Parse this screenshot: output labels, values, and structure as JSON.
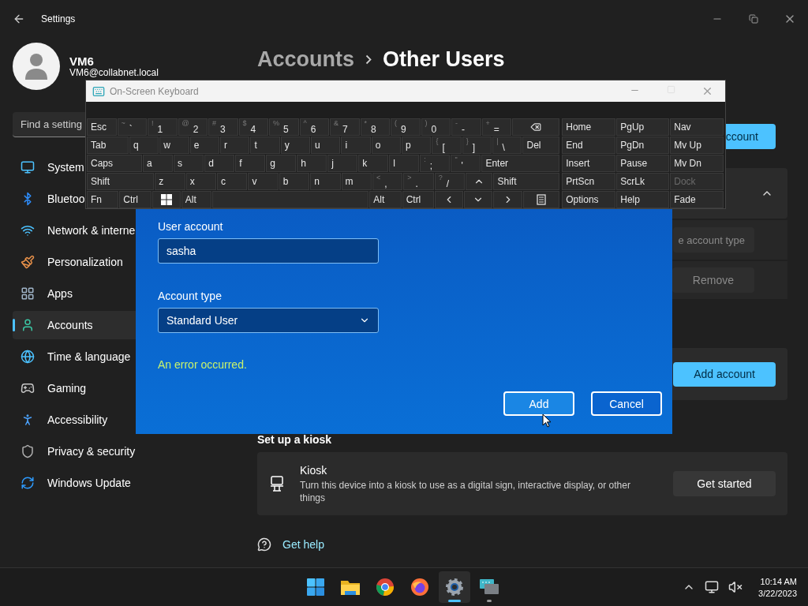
{
  "settings": {
    "title": "Settings",
    "user": {
      "name": "VM6",
      "email": "VM6@collabnet.local"
    },
    "search": {
      "placeholder": "Find a setting"
    },
    "nav": [
      {
        "label": "System",
        "kind": "system",
        "selected": false
      },
      {
        "label": "Bluetoo",
        "kind": "bluetooth",
        "selected": false
      },
      {
        "label": "Network & interne",
        "kind": "network",
        "selected": false
      },
      {
        "label": "Personalization",
        "kind": "personalization",
        "selected": false
      },
      {
        "label": "Apps",
        "kind": "apps",
        "selected": false
      },
      {
        "label": "Accounts",
        "kind": "accounts",
        "selected": true
      },
      {
        "label": "Time & language",
        "kind": "time",
        "selected": false
      },
      {
        "label": "Gaming",
        "kind": "gaming",
        "selected": false
      },
      {
        "label": "Accessibility",
        "kind": "accessibility",
        "selected": false
      },
      {
        "label": "Privacy & security",
        "kind": "privacy",
        "selected": false
      },
      {
        "label": "Windows Update",
        "kind": "update",
        "selected": false
      }
    ],
    "breadcrumb": {
      "parent": "Accounts",
      "current": "Other Users"
    },
    "other_users": {
      "button": "ccount",
      "account": {
        "expanded": true
      },
      "options": [
        {
          "label": "e account type",
          "disabled": true
        },
        {
          "label": "Remove",
          "disabled": true
        }
      ]
    },
    "work_account": {
      "button": "Add account"
    },
    "kiosk": {
      "heading": "Set up a kiosk",
      "title": "Kiosk",
      "description": "Turn this device into a kiosk to use as a digital sign, interactive display, or other things",
      "button": "Get started"
    },
    "help": {
      "label": "Get help"
    }
  },
  "keyboard": {
    "title": "On-Screen Keyboard",
    "rows": [
      [
        {
          "kind": "text",
          "label": "Esc"
        },
        {
          "kind": "char",
          "shift": "~",
          "label": "`"
        },
        {
          "kind": "char",
          "shift": "!",
          "label": "1"
        },
        {
          "kind": "char",
          "shift": "@",
          "label": "2"
        },
        {
          "kind": "char",
          "shift": "#",
          "label": "3"
        },
        {
          "kind": "char",
          "shift": "$",
          "label": "4"
        },
        {
          "kind": "char",
          "shift": "%",
          "label": "5"
        },
        {
          "kind": "char",
          "shift": "^",
          "label": "6"
        },
        {
          "kind": "char",
          "shift": "&",
          "label": "7"
        },
        {
          "kind": "char",
          "shift": "*",
          "label": "8"
        },
        {
          "kind": "char",
          "shift": "(",
          "label": "9"
        },
        {
          "kind": "char",
          "shift": ")",
          "label": "0"
        },
        {
          "kind": "char",
          "shift": "-",
          "label": "-"
        },
        {
          "kind": "char",
          "shift": "+",
          "label": "="
        },
        {
          "kind": "backspace"
        }
      ],
      [
        {
          "kind": "text",
          "label": "Tab"
        },
        {
          "kind": "text",
          "label": "q"
        },
        {
          "kind": "text",
          "label": "w"
        },
        {
          "kind": "text",
          "label": "e"
        },
        {
          "kind": "text",
          "label": "r"
        },
        {
          "kind": "text",
          "label": "t"
        },
        {
          "kind": "text",
          "label": "y"
        },
        {
          "kind": "text",
          "label": "u"
        },
        {
          "kind": "text",
          "label": "i"
        },
        {
          "kind": "text",
          "label": "o"
        },
        {
          "kind": "text",
          "label": "p"
        },
        {
          "kind": "char",
          "shift": "{",
          "label": "["
        },
        {
          "kind": "char",
          "shift": "}",
          "label": "]"
        },
        {
          "kind": "char",
          "shift": "|",
          "label": "\\"
        },
        {
          "kind": "text",
          "label": "Del"
        }
      ],
      [
        {
          "kind": "text",
          "label": "Caps"
        },
        {
          "kind": "text",
          "label": "a"
        },
        {
          "kind": "text",
          "label": "s"
        },
        {
          "kind": "text",
          "label": "d"
        },
        {
          "kind": "text",
          "label": "f"
        },
        {
          "kind": "text",
          "label": "g"
        },
        {
          "kind": "text",
          "label": "h"
        },
        {
          "kind": "text",
          "label": "j"
        },
        {
          "kind": "text",
          "label": "k"
        },
        {
          "kind": "text",
          "label": "l"
        },
        {
          "kind": "char",
          "shift": ":",
          "label": ";"
        },
        {
          "kind": "char",
          "shift": "\"",
          "label": "'"
        },
        {
          "kind": "text",
          "label": "Enter"
        }
      ],
      [
        {
          "kind": "text",
          "label": "Shift"
        },
        {
          "kind": "text",
          "label": "z"
        },
        {
          "kind": "text",
          "label": "x"
        },
        {
          "kind": "text",
          "label": "c"
        },
        {
          "kind": "text",
          "label": "v"
        },
        {
          "kind": "text",
          "label": "b"
        },
        {
          "kind": "text",
          "label": "n"
        },
        {
          "kind": "text",
          "label": "m"
        },
        {
          "kind": "char",
          "shift": "<",
          "label": ","
        },
        {
          "kind": "char",
          "shift": ">",
          "label": "."
        },
        {
          "kind": "char",
          "shift": "?",
          "label": "/"
        },
        {
          "kind": "up"
        },
        {
          "kind": "text",
          "label": "Shift"
        }
      ],
      [
        {
          "kind": "text",
          "label": "Fn"
        },
        {
          "kind": "text",
          "label": "Ctrl"
        },
        {
          "kind": "win"
        },
        {
          "kind": "text",
          "label": "Alt"
        },
        {
          "kind": "space"
        },
        {
          "kind": "text",
          "label": "Alt"
        },
        {
          "kind": "text",
          "label": "Ctrl"
        },
        {
          "kind": "left"
        },
        {
          "kind": "down"
        },
        {
          "kind": "right"
        },
        {
          "kind": "menu"
        }
      ]
    ],
    "nav_rows": [
      [
        {
          "label": "Home",
          "disabled": false
        },
        {
          "label": "PgUp",
          "disabled": false
        },
        {
          "label": "Nav",
          "disabled": false
        }
      ],
      [
        {
          "label": "End",
          "disabled": false
        },
        {
          "label": "PgDn",
          "disabled": false
        },
        {
          "label": "Mv Up",
          "disabled": false
        }
      ],
      [
        {
          "label": "Insert",
          "disabled": false
        },
        {
          "label": "Pause",
          "disabled": false
        },
        {
          "label": "Mv Dn",
          "disabled": false
        }
      ],
      [
        {
          "label": "PrtScn",
          "disabled": false
        },
        {
          "label": "ScrLk",
          "disabled": false
        },
        {
          "label": "Dock",
          "disabled": true
        }
      ],
      [
        {
          "label": "Options",
          "disabled": false
        },
        {
          "label": "Help",
          "disabled": false
        },
        {
          "label": "Fade",
          "disabled": false
        }
      ]
    ]
  },
  "dialog": {
    "fields": [
      {
        "kind": "text",
        "label": "User account",
        "value": "sasha"
      },
      {
        "kind": "select",
        "label": "Account type",
        "value": "Standard User"
      }
    ],
    "error": "An error occurred.",
    "buttons": [
      {
        "label": "Add",
        "primary": true
      },
      {
        "label": "Cancel",
        "primary": false
      }
    ]
  },
  "taskbar": {
    "apps": [
      {
        "kind": "start",
        "active": false,
        "running": false
      },
      {
        "kind": "folder",
        "active": false,
        "running": false
      },
      {
        "kind": "browser",
        "active": false,
        "running": false
      },
      {
        "kind": "fox",
        "active": false,
        "running": false
      },
      {
        "kind": "gear",
        "active": true,
        "running": true
      },
      {
        "kind": "keyboard",
        "active": false,
        "running": true
      }
    ],
    "clock": {
      "time": "10:14 AM",
      "date": "3/22/2023"
    }
  }
}
